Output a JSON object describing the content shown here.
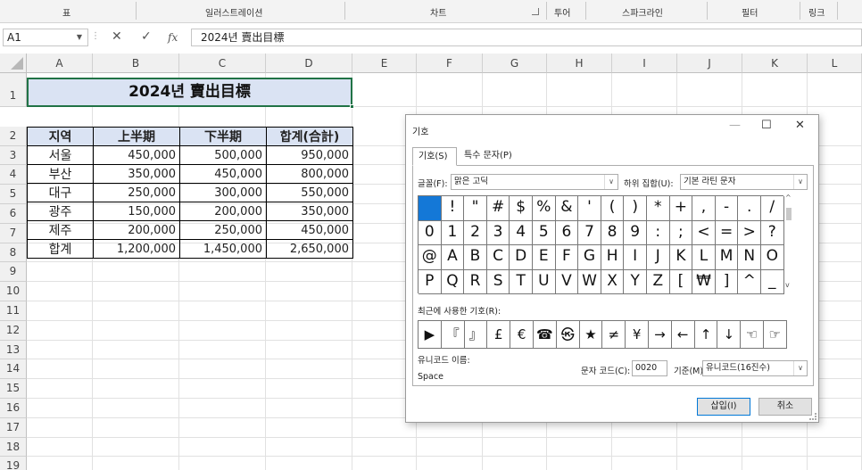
{
  "ribbon": {
    "groups": [
      "표",
      "일러스트레이션",
      "차트",
      "투어",
      "스파크라인",
      "필터",
      "링크"
    ]
  },
  "formula_bar": {
    "name_box": "A1",
    "formula": "2024년 賣出目標"
  },
  "sheet": {
    "columns": [
      "A",
      "B",
      "C",
      "D",
      "E",
      "F",
      "G",
      "H",
      "I",
      "J",
      "K",
      "L"
    ],
    "rows": [
      "1",
      "2",
      "3",
      "4",
      "5",
      "6",
      "7",
      "8",
      "9",
      "10",
      "11",
      "12",
      "13",
      "14",
      "15",
      "16",
      "17",
      "18",
      "19"
    ],
    "title": "2024년 賣出目標",
    "table_headers": [
      "지역",
      "上半期",
      "下半期",
      "합계(合計)"
    ],
    "table_rows": [
      [
        "서울",
        "450,000",
        "500,000",
        "950,000"
      ],
      [
        "부산",
        "350,000",
        "450,000",
        "800,000"
      ],
      [
        "대구",
        "250,000",
        "300,000",
        "550,000"
      ],
      [
        "광주",
        "150,000",
        "200,000",
        "350,000"
      ],
      [
        "제주",
        "200,000",
        "250,000",
        "450,000"
      ],
      [
        "합계",
        "1,200,000",
        "1,450,000",
        "2,650,000"
      ]
    ]
  },
  "dialog": {
    "title": "기호",
    "tabs": [
      "기호(S)",
      "특수 문자(P)"
    ],
    "font_label": "글꼴(F):",
    "font_value": "맑은 고딕",
    "subset_label": "하위 집합(U):",
    "subset_value": "기본 라틴 문자",
    "symbols": [
      " ",
      "!",
      "\"",
      "#",
      "$",
      "%",
      "&",
      "'",
      "(",
      ")",
      "*",
      "+",
      ",",
      "-",
      ".",
      "/",
      "0",
      "1",
      "2",
      "3",
      "4",
      "5",
      "6",
      "7",
      "8",
      "9",
      ":",
      ";",
      "<",
      "=",
      ">",
      "?",
      "@",
      "A",
      "B",
      "C",
      "D",
      "E",
      "F",
      "G",
      "H",
      "I",
      "J",
      "K",
      "L",
      "M",
      "N",
      "O",
      "P",
      "Q",
      "R",
      "S",
      "T",
      "U",
      "V",
      "W",
      "X",
      "Y",
      "Z",
      "[",
      "₩",
      "]",
      "^",
      "_"
    ],
    "recent_label": "최근에 사용한 기호(R):",
    "recent_symbols": [
      "▶",
      "『",
      "』",
      "£",
      "€",
      "☎",
      "㉿",
      "★",
      "≠",
      "¥",
      "→",
      "←",
      "↑",
      "↓",
      "☜",
      "☞"
    ],
    "unicode_name_label": "유니코드 이름:",
    "unicode_name_value": "Space",
    "char_code_label": "문자 코드(C):",
    "char_code_value": "0020",
    "from_label": "기준(M):",
    "from_value": "유니코드(16진수)",
    "insert_button": "삽입(I)",
    "cancel_button": "취소",
    "minimize": "—",
    "maximize": "☐",
    "close": "✕"
  }
}
